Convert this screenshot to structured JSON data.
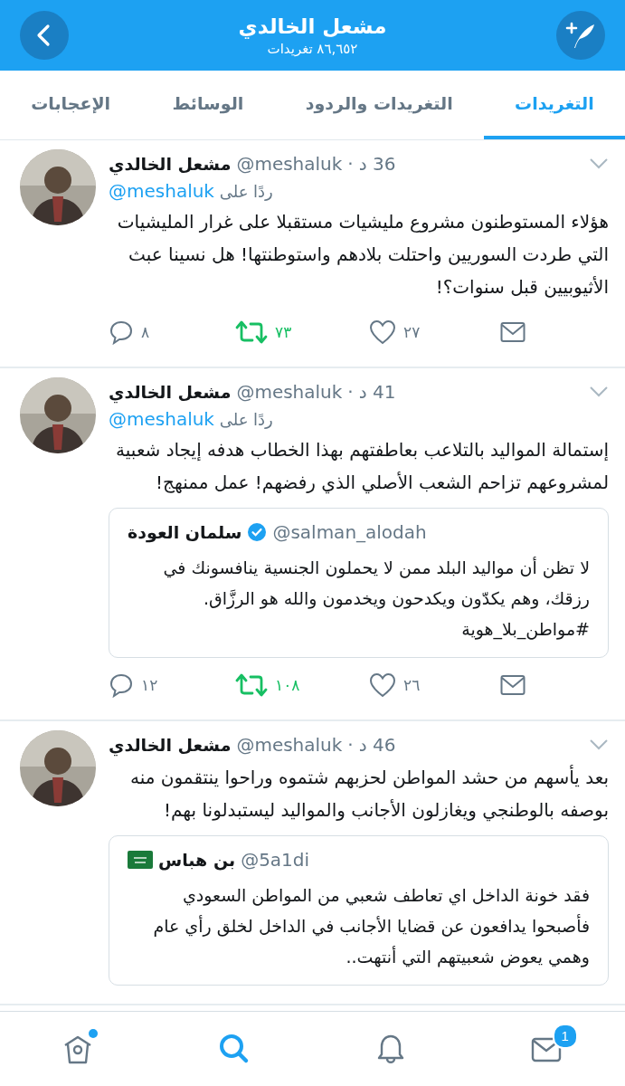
{
  "header": {
    "title": "مشعل الخالدي",
    "subtitle": "٨٦,٦٥٢ تغريدات"
  },
  "tabs": [
    {
      "label": "التغريدات",
      "selected": true
    },
    {
      "label": "التغريدات والردود",
      "selected": false
    },
    {
      "label": "الوسائط",
      "selected": false
    },
    {
      "label": "الإعجابات",
      "selected": false
    }
  ],
  "tweets": [
    {
      "author": "مشعل الخالدي",
      "handle": "@meshaluk",
      "separator": "·",
      "time": "36 د",
      "reply_prefix": "ردًا على",
      "reply_to": "@meshaluk",
      "text": "هؤلاء المستوطنون مشروع مليشيات مستقبلا على غرار المليشيات التي طردت السوريين واحتلت بلادهم واستوطنتها! هل نسينا عبث الأثيوبيين قبل سنوات؟!",
      "actions": {
        "replies": "٨",
        "retweets": "٧٣",
        "retweeted": true,
        "likes": "٢٧"
      }
    },
    {
      "author": "مشعل الخالدي",
      "handle": "@meshaluk",
      "separator": "·",
      "time": "41 د",
      "reply_prefix": "ردًا على",
      "reply_to": "@meshaluk",
      "text": "إستمالة المواليد بالتلاعب بعاطفتهم بهذا الخطاب هدفه إيجاد شعبية لمشروعهم تزاحم الشعب الأصلي الذي رفضهم! عمل ممنهج!",
      "quote": {
        "name": "سلمان العودة",
        "verified": true,
        "handle": "@salman_alodah",
        "text": "لا تظن أن مواليد البلد ممن لا يحملون الجنسية ينافسونك في رزقك، وهم يكدّون ويكدحون ويخدمون والله هو الرزَّاق.\n#مواطن_بلا_هوية"
      },
      "actions": {
        "replies": "١٢",
        "retweets": "١٠٨",
        "retweeted": true,
        "likes": "٢٦"
      }
    },
    {
      "author": "مشعل الخالدي",
      "handle": "@meshaluk",
      "separator": "·",
      "time": "46 د",
      "text": "بعد يأسهم من حشد المواطن لحزبهم شتموه وراحوا ينتقمون منه بوصفه بالوطنجي ويغازلون الأجانب والمواليد ليستبدلونا بهم!",
      "quote": {
        "name": "بن هباس",
        "flag": true,
        "handle": "@5a1di",
        "text": "فقد خونة الداخل اي تعاطف شعبي من المواطن السعودي فأصبحوا يدافعون عن قضايا الأجانب في الداخل لخلق رأي عام وهمي يعوض شعبيتهم التي أنتهت.."
      }
    }
  ],
  "nav": [
    {
      "kind": "home",
      "selected": false,
      "new_dot": true
    },
    {
      "kind": "search",
      "selected": true
    },
    {
      "kind": "notifications",
      "selected": false
    },
    {
      "kind": "messages",
      "selected": false,
      "badge": "1"
    }
  ]
}
